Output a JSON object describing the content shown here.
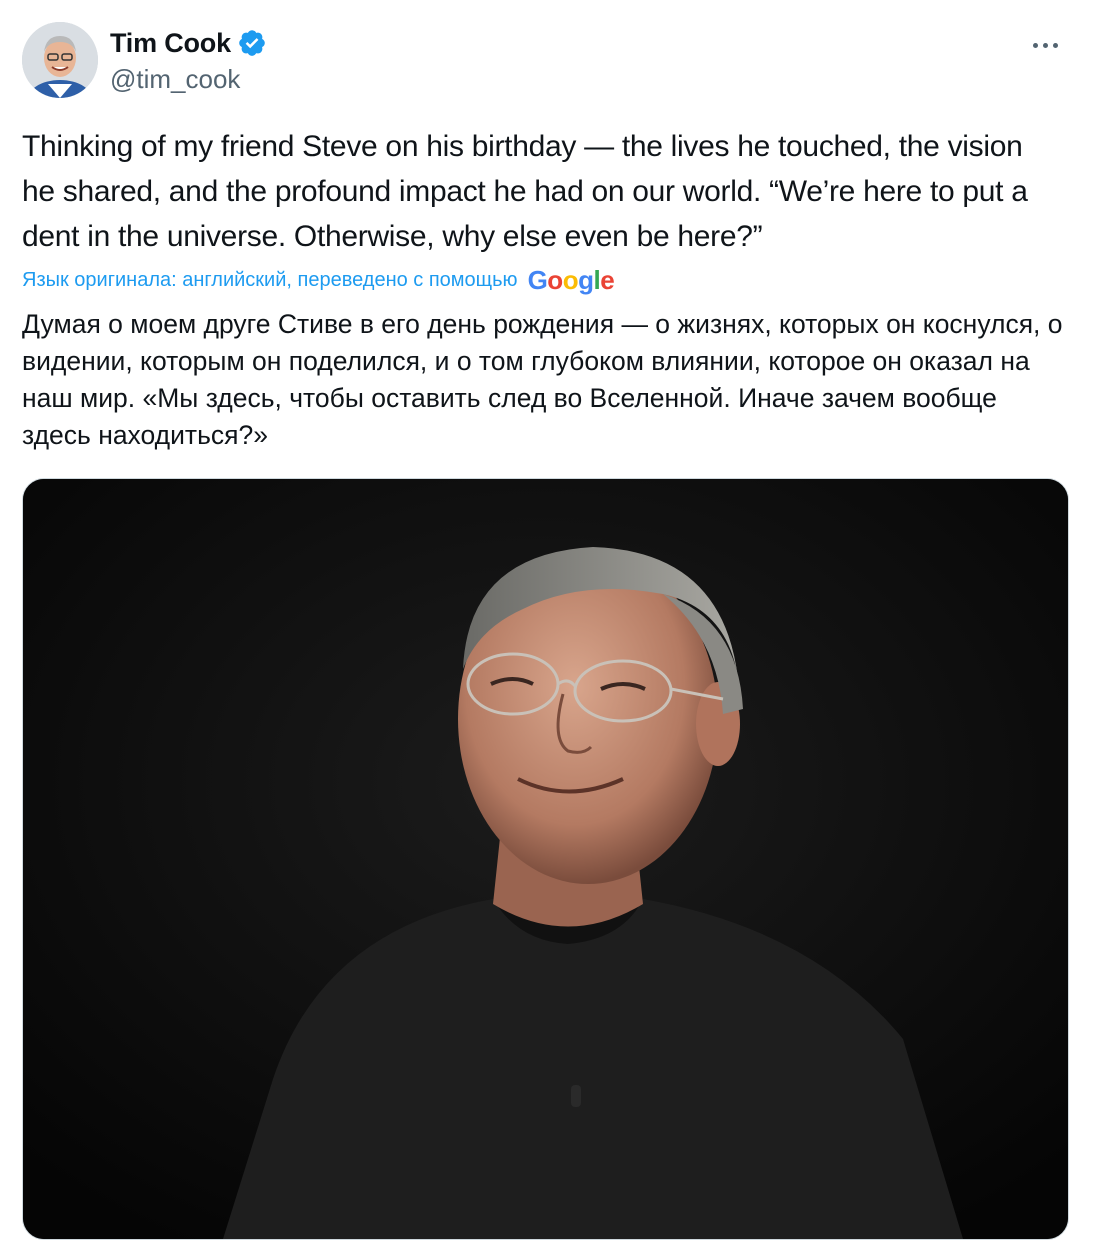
{
  "author": {
    "name": "Tim Cook",
    "handle": "@tim_cook",
    "verified_icon": "verified-badge-icon",
    "avatar_icon": "avatar-photo"
  },
  "menu": {
    "icon": "more-horizontal-icon"
  },
  "tweet": {
    "text": "Thinking of my friend Steve on his birthday — the lives he touched, the vision he shared, and the profound impact he had on our world. “We’re here to put a dent in the universe. Otherwise, why else even be here?”"
  },
  "translation": {
    "notice": "Язык оригинала: английский, переведено с помощью",
    "provider": "Google",
    "text": "Думая о моем друге Стиве в его день рождения — о жизнях, которых он коснулся, о видении, которым он поделился, и о том глубоком влиянии, которое он оказал на наш мир. «Мы здесь, чтобы оставить след во Вселенной. Иначе зачем вообще здесь находиться?»"
  },
  "media": {
    "icon": "photo-of-steve-jobs"
  },
  "colors": {
    "link": "#1d9bf0",
    "secondary_text": "#536471",
    "primary_text": "#0f1419",
    "verified": "#1d9bf0"
  }
}
